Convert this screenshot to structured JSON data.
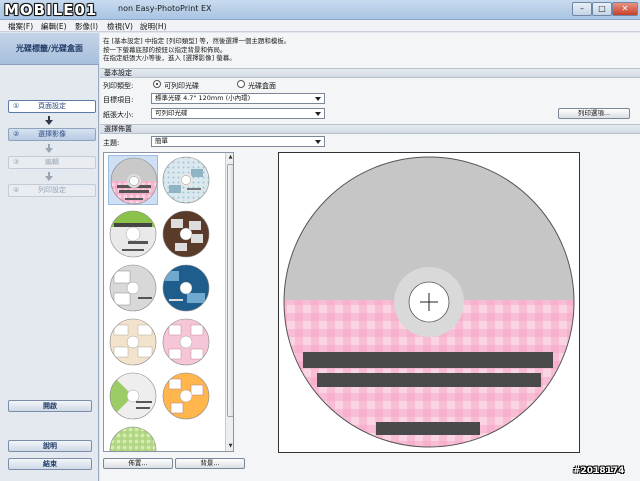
{
  "window": {
    "logo": "MOBILE01",
    "title": "non Easy-PhotoPrint EX",
    "controls": {
      "minimize": "–",
      "maximize": "□",
      "close": "✕"
    }
  },
  "menu": {
    "items": [
      "檔案(F)",
      "編輯(E)",
      "影像(I)",
      "檢視(V)",
      "說明(H)"
    ]
  },
  "sidebar": {
    "header": "光碟標籤/光碟盒面",
    "steps": [
      {
        "num": "①",
        "label": "頁面設定",
        "state": "active"
      },
      {
        "num": "②",
        "label": "選擇影像",
        "state": "done"
      },
      {
        "num": "③",
        "label": "編輯",
        "state": "disabled"
      },
      {
        "num": "④",
        "label": "列印設定",
        "state": "disabled"
      }
    ],
    "open_button": "開啟",
    "help_button": "說明",
    "exit_button": "結束"
  },
  "instructions": {
    "line1": "在 [基本設定] 中指定 [列印類型] 等，然後選擇一個主題和模板。",
    "line2": "按一下螢幕底部的按鈕以指定背景和佈局。",
    "line3": "在指定紙張大小等後，進入 [選擇影像] 螢幕。"
  },
  "basic_settings": {
    "heading": "基本設定",
    "print_type_label": "列印類型:",
    "option_disc": "可列印光碟",
    "option_case": "光碟盒面",
    "selected_option": "disc",
    "target_label": "目標項目:",
    "target_value": "標準光碟 4.7\" 120mm (小內環)",
    "paper_label": "紙張大小:",
    "paper_value": "可列印光碟",
    "print_options_button": "列印選項..."
  },
  "layout_section": {
    "heading": "選擇佈置",
    "theme_label": "主題:",
    "theme_value": "簡單",
    "layout_button": "佈置...",
    "background_button": "背景..."
  },
  "colors": {
    "disc_gray": "#c6c6c6",
    "plaid_pink_light": "#fbd4e4",
    "plaid_pink_dark": "#f6a8c8",
    "label_bar": "#4a4a4a",
    "accent_blue": "#2a4a80"
  },
  "watermark": "#2018174"
}
